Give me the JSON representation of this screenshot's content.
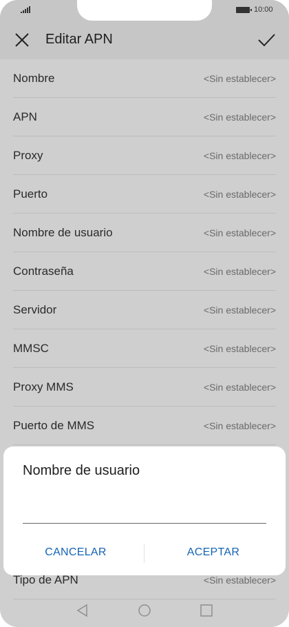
{
  "status_bar": {
    "time": "10:00",
    "icons": [
      "signal-icon",
      "battery-icon"
    ]
  },
  "header": {
    "title": "Editar APN",
    "close_icon": "close-icon",
    "confirm_icon": "check-icon"
  },
  "fields": [
    {
      "label": "Nombre",
      "value": "<Sin establecer>"
    },
    {
      "label": "APN",
      "value": "<Sin establecer>"
    },
    {
      "label": "Proxy",
      "value": "<Sin establecer>"
    },
    {
      "label": "Puerto",
      "value": "<Sin establecer>"
    },
    {
      "label": "Nombre de usuario",
      "value": "<Sin establecer>"
    },
    {
      "label": "Contraseña",
      "value": "<Sin establecer>"
    },
    {
      "label": "Servidor",
      "value": "<Sin establecer>"
    },
    {
      "label": "MMSC",
      "value": "<Sin establecer>"
    },
    {
      "label": "Proxy MMS",
      "value": "<Sin establecer>"
    },
    {
      "label": "Puerto de MMS",
      "value": "<Sin establecer>"
    }
  ],
  "last_field": {
    "label": "Tipo de APN",
    "value": "<Sin establecer>"
  },
  "dialog": {
    "title": "Nombre de usuario",
    "input_value": "",
    "cancel_label": "CANCELAR",
    "accept_label": "ACEPTAR"
  },
  "nav_bar": {
    "icons": [
      "back-icon",
      "home-icon",
      "recents-icon"
    ]
  },
  "colors": {
    "accent": "#1463b5",
    "overlay": "#cfcfcf",
    "dialog_bg": "#ffffff"
  }
}
